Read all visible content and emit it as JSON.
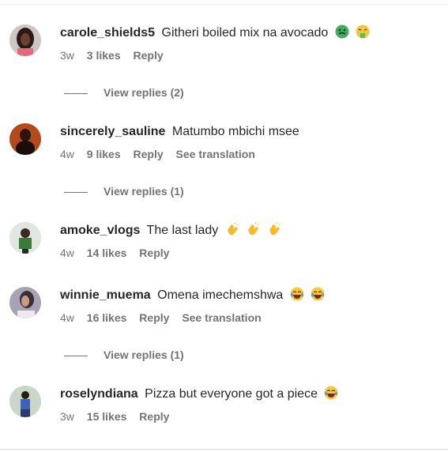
{
  "comments": [
    {
      "username": "carole_shields5",
      "text": "Githeri boiled mix na avocado",
      "emojis": [
        "nauseated-face",
        "vomiting-face"
      ],
      "time": "3w",
      "likes": "3 likes",
      "reply": "Reply",
      "see_translation": "",
      "view_replies": "View replies (2)"
    },
    {
      "username": "sincerely_sauline",
      "text": "Matumbo mbichi msee",
      "emojis": [],
      "time": "4w",
      "likes": "9 likes",
      "reply": "Reply",
      "see_translation": "See translation",
      "view_replies": "View replies (1)"
    },
    {
      "username": "amoke_vlogs",
      "text": "The last lady",
      "emojis": [
        "clapping-hands",
        "clapping-hands",
        "clapping-hands"
      ],
      "time": "4w",
      "likes": "14 likes",
      "reply": "Reply",
      "see_translation": "",
      "view_replies": ""
    },
    {
      "username": "winnie_muema",
      "text": "Omena imechemshwa",
      "emojis": [
        "tears-of-joy",
        "tears-of-joy"
      ],
      "time": "4w",
      "likes": "16 likes",
      "reply": "Reply",
      "see_translation": "See translation",
      "view_replies": "View replies (1)"
    },
    {
      "username": "roselyndiana",
      "text": "Pizza but everyone got a piece",
      "emojis": [
        "tears-of-joy"
      ],
      "time": "3w",
      "likes": "15 likes",
      "reply": "Reply",
      "see_translation": "",
      "view_replies": ""
    }
  ],
  "colors": {
    "text": "#262626",
    "secondary": "#737373"
  }
}
